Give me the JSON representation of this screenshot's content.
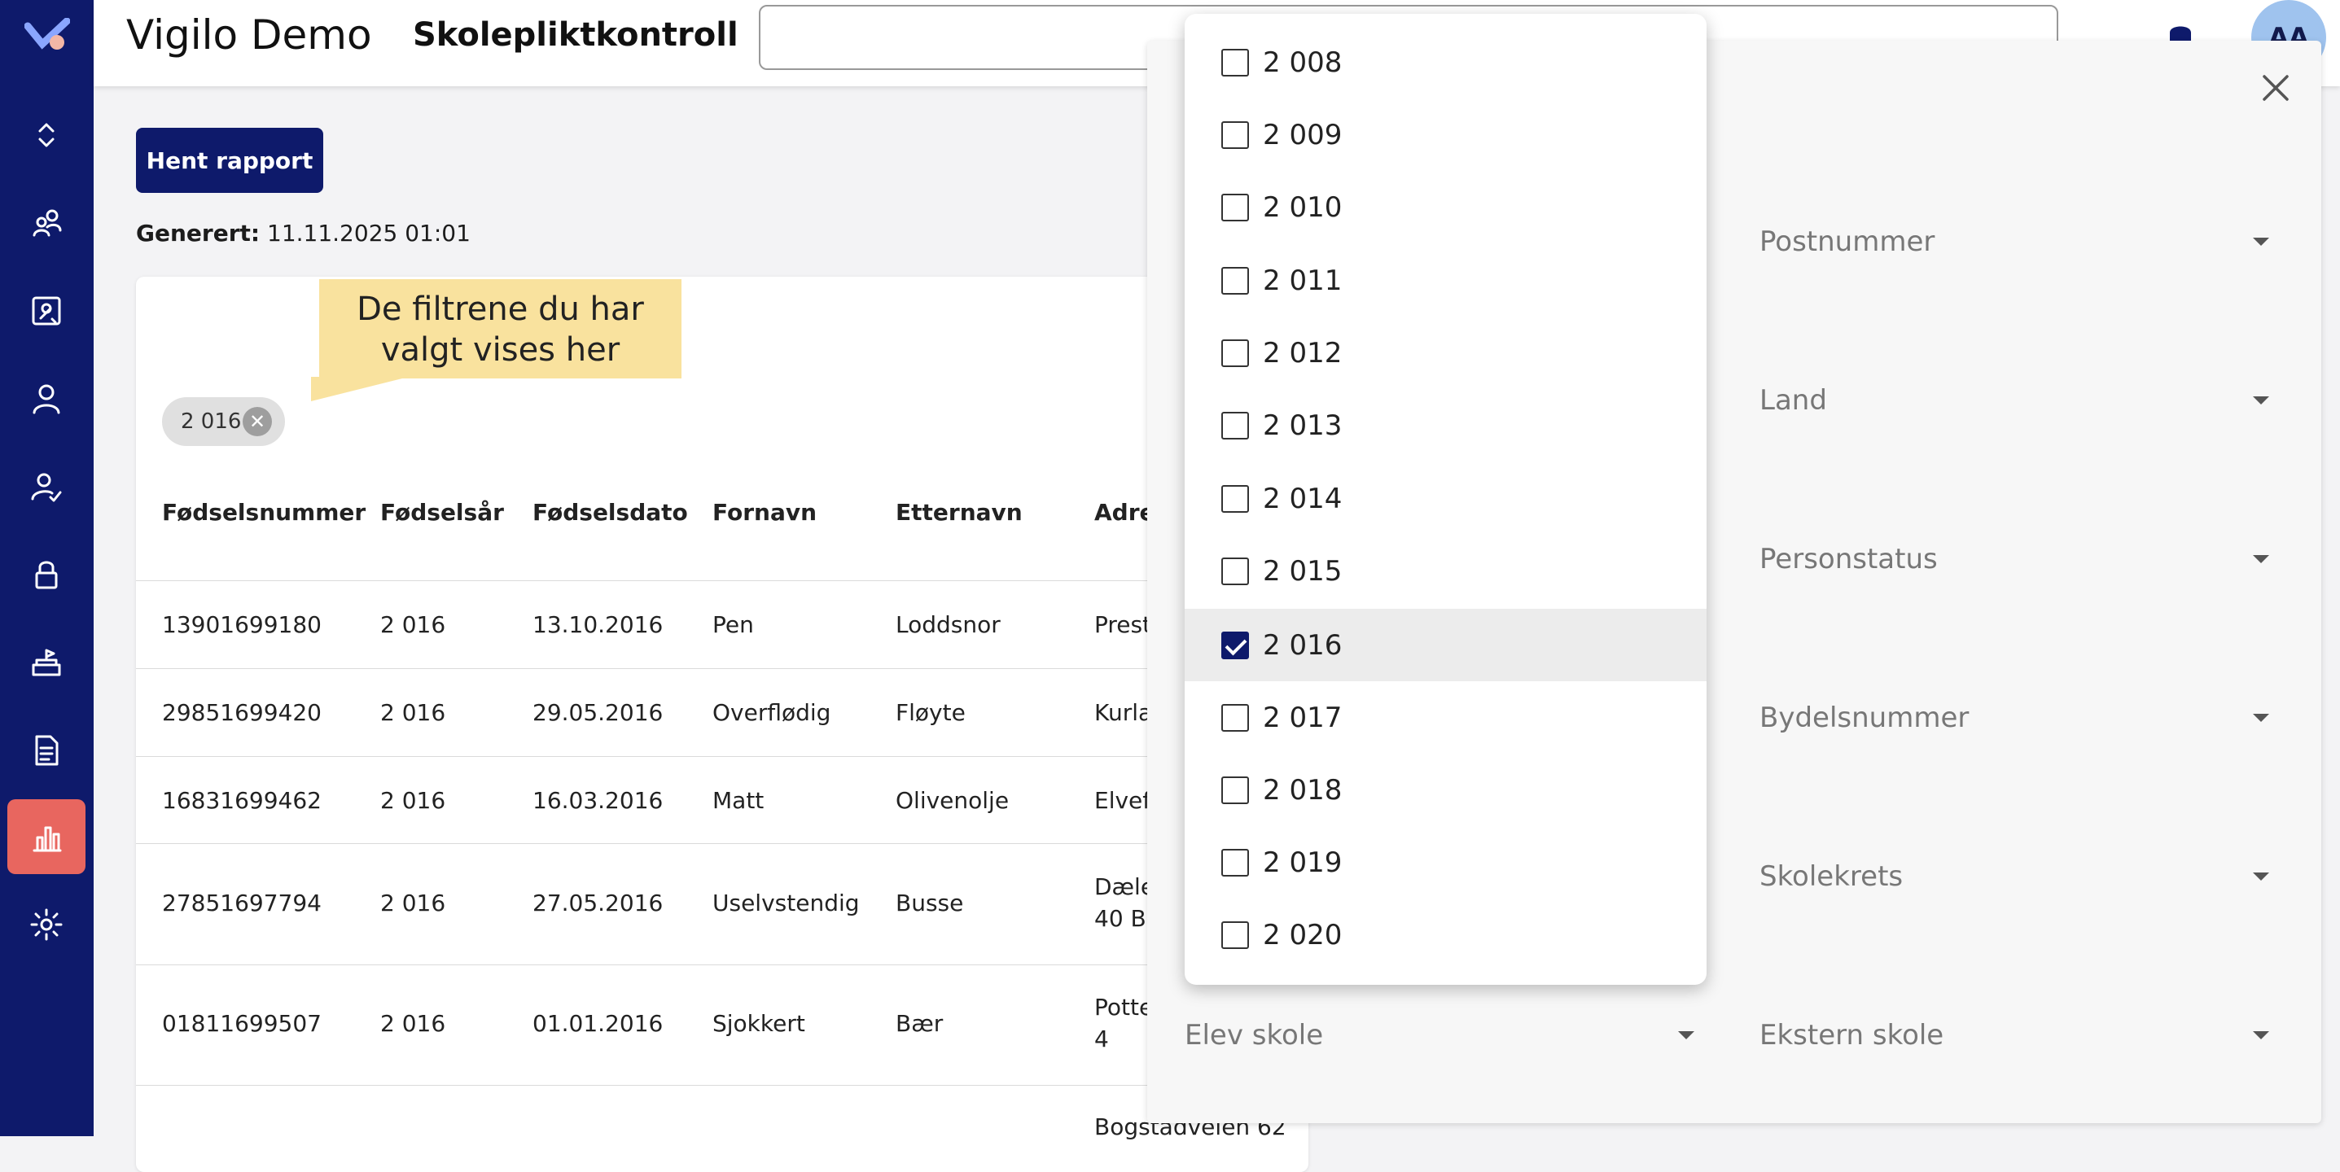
{
  "header": {
    "app_title": "Vigilo Demo",
    "page_title": "Skolepliktkontroll",
    "search_placeholder": "",
    "avatar_initials": "AA"
  },
  "sidebar": {
    "items": [
      {
        "icon": "collapse-icon"
      },
      {
        "icon": "users-icon"
      },
      {
        "icon": "network-icon"
      },
      {
        "icon": "person-icon"
      },
      {
        "icon": "person-check-icon"
      },
      {
        "icon": "lock-icon"
      },
      {
        "icon": "school-icon"
      },
      {
        "icon": "document-icon"
      },
      {
        "icon": "bar-chart-icon",
        "active": true
      },
      {
        "icon": "gear-icon"
      }
    ],
    "colors": {
      "background": "#0e1a6b",
      "active": "#e8665f"
    }
  },
  "main": {
    "fetch_button": "Hent rapport",
    "generated_label": "Generert:",
    "generated_value": "11.11.2025 01:01",
    "tooltip": "De filtrene du har valgt vises her",
    "chip": "2 016",
    "table": {
      "headers": [
        "Fødselsnummer",
        "Fødselsår",
        "Fødselsdato",
        "Fornavn",
        "Etternavn",
        "Adre"
      ],
      "rows": [
        [
          "13901699180",
          "2 016",
          "13.10.2016",
          "Pen",
          "Loddsnor",
          "Prest"
        ],
        [
          "29851699420",
          "2 016",
          "29.05.2016",
          "Overflødig",
          "Fløyte",
          "Kurla"
        ],
        [
          "16831699462",
          "2 016",
          "16.03.2016",
          "Matt",
          "Olivenolje",
          "Elvef"
        ],
        [
          "27851697794",
          "2 016",
          "27.05.2016",
          "Uselvstendig",
          "Busse",
          "Dæle"
        ],
        [
          "01811699507",
          "2 016",
          "01.01.2016",
          "Sjokkert",
          "Bær",
          "Potte"
        ]
      ],
      "row4_address_line2": "40 B",
      "row5_address_line2": "4",
      "partial_row_address": "Bogstadveien 62"
    }
  },
  "year_dropdown": {
    "options": [
      {
        "label": "2 008",
        "checked": false
      },
      {
        "label": "2 009",
        "checked": false
      },
      {
        "label": "2 010",
        "checked": false
      },
      {
        "label": "2 011",
        "checked": false
      },
      {
        "label": "2 012",
        "checked": false
      },
      {
        "label": "2 013",
        "checked": false
      },
      {
        "label": "2 014",
        "checked": false
      },
      {
        "label": "2 015",
        "checked": false
      },
      {
        "label": "2 016",
        "checked": true
      },
      {
        "label": "2 017",
        "checked": false
      },
      {
        "label": "2 018",
        "checked": false
      },
      {
        "label": "2 019",
        "checked": false
      },
      {
        "label": "2 020",
        "checked": false
      }
    ]
  },
  "filter_panel": {
    "fields": {
      "postnummer": "Postnummer",
      "land": "Land",
      "personstatus": "Personstatus",
      "bydelsnummer": "Bydelsnummer",
      "skolekrets": "Skolekrets",
      "elev_skole": "Elev skole",
      "ekstern_skole": "Ekstern skole"
    }
  }
}
